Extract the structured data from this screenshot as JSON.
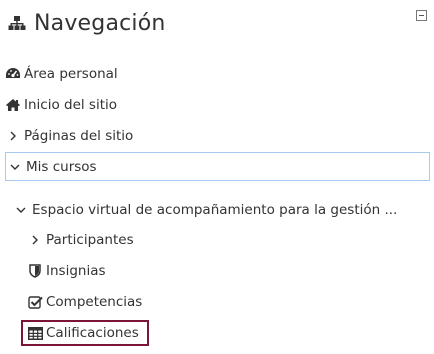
{
  "header": {
    "title": "Navegación",
    "icon": "sitemap-icon",
    "collapse_icon": "collapse-icon"
  },
  "nav": {
    "area_personal": {
      "label": "Área personal",
      "icon": "dashboard-icon"
    },
    "inicio_sitio": {
      "label": "Inicio del sitio",
      "icon": "home-icon"
    },
    "paginas_sitio": {
      "label": "Páginas del sitio",
      "icon": "chevron-right-icon",
      "expanded": false
    },
    "mis_cursos": {
      "label": "Mis cursos",
      "icon": "chevron-down-icon",
      "expanded": true
    },
    "course": {
      "label": "Espacio virtual de acompañamiento para la gestión ...",
      "icon": "chevron-down-icon",
      "expanded": true,
      "children": {
        "participantes": {
          "label": "Participantes",
          "icon": "chevron-right-icon"
        },
        "insignias": {
          "label": "Insignias",
          "icon": "shield-icon"
        },
        "competencias": {
          "label": "Competencias",
          "icon": "checkbox-icon"
        },
        "calificaciones": {
          "label": "Calificaciones",
          "icon": "table-icon",
          "highlighted": true
        }
      }
    }
  },
  "colors": {
    "text": "#333333",
    "focus_border": "#a7c8ef",
    "highlight_border": "#7a1537"
  }
}
